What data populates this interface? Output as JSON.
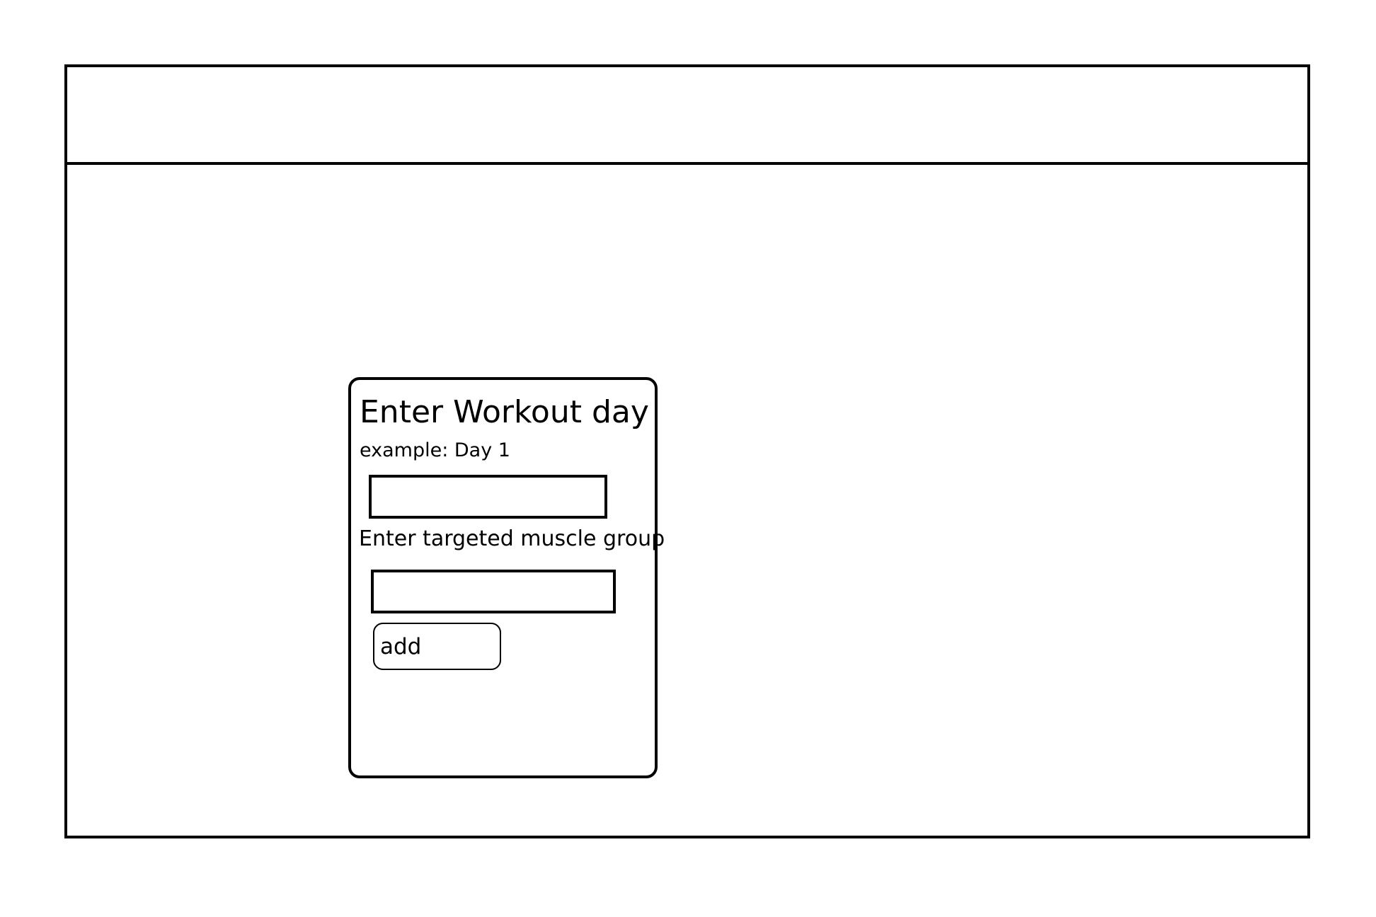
{
  "form": {
    "title": "Enter Workout day",
    "day_hint": "example: Day 1",
    "day_value": "",
    "muscle_label": "Enter targeted muscle group",
    "muscle_value": "",
    "add_label": "add"
  }
}
